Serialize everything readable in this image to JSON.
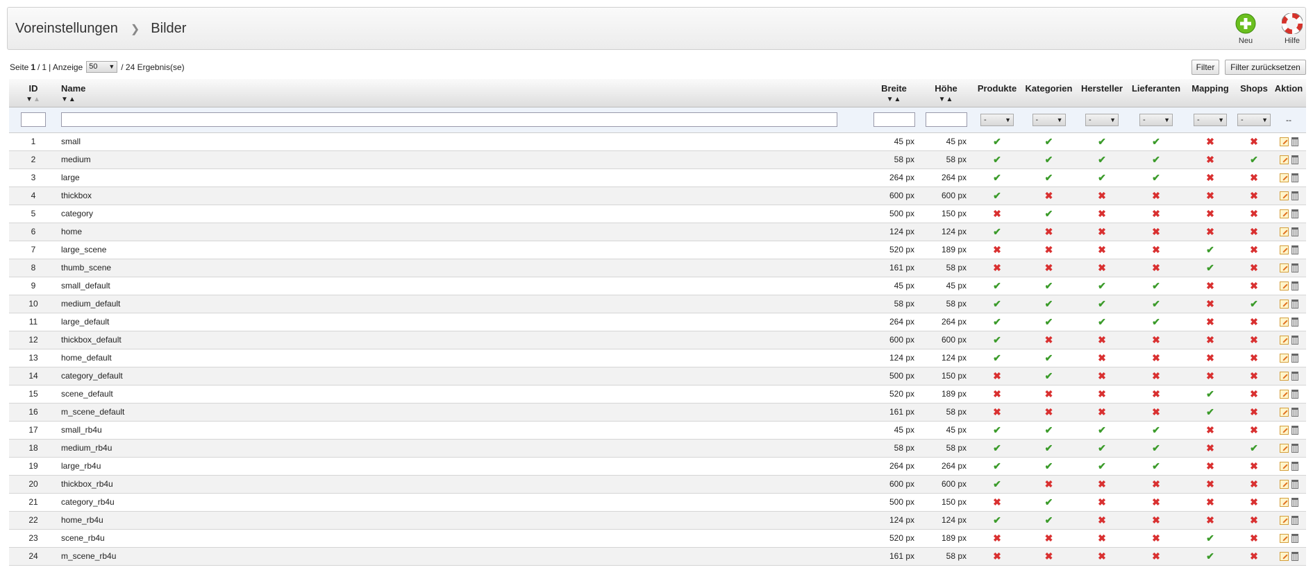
{
  "breadcrumb": {
    "parent": "Voreinstellungen",
    "current": "Bilder"
  },
  "toolbar": {
    "new_label": "Neu",
    "help_label": "Hilfe"
  },
  "pagination": {
    "page_label": "Seite",
    "page": "1",
    "sep": "/",
    "pages": "1",
    "display_label": "| Anzeige",
    "per_page": "50",
    "result_text": "/ 24 Ergebnis(se)"
  },
  "buttons": {
    "filter": "Filter",
    "reset": "Filter zurücksetzen"
  },
  "columns": {
    "id": "ID",
    "name": "Name",
    "width": "Breite",
    "height": "Höhe",
    "products": "Produkte",
    "categories": "Kategorien",
    "manufacturers": "Hersteller",
    "suppliers": "Lieferanten",
    "mapping": "Mapping",
    "shops": "Shops",
    "action": "Aktion"
  },
  "filter": {
    "select_value": "-",
    "action_placeholder": "--"
  },
  "colors": {
    "check": "#3b9b2a",
    "cross": "#d93030",
    "new_button": "#6bbf1f"
  },
  "rows": [
    {
      "id": "1",
      "name": "small",
      "w": "45 px",
      "h": "45 px",
      "f": [
        1,
        1,
        1,
        1,
        0,
        0
      ]
    },
    {
      "id": "2",
      "name": "medium",
      "w": "58 px",
      "h": "58 px",
      "f": [
        1,
        1,
        1,
        1,
        0,
        1
      ]
    },
    {
      "id": "3",
      "name": "large",
      "w": "264 px",
      "h": "264 px",
      "f": [
        1,
        1,
        1,
        1,
        0,
        0
      ]
    },
    {
      "id": "4",
      "name": "thickbox",
      "w": "600 px",
      "h": "600 px",
      "f": [
        1,
        0,
        0,
        0,
        0,
        0
      ]
    },
    {
      "id": "5",
      "name": "category",
      "w": "500 px",
      "h": "150 px",
      "f": [
        0,
        1,
        0,
        0,
        0,
        0
      ]
    },
    {
      "id": "6",
      "name": "home",
      "w": "124 px",
      "h": "124 px",
      "f": [
        1,
        0,
        0,
        0,
        0,
        0
      ]
    },
    {
      "id": "7",
      "name": "large_scene",
      "w": "520 px",
      "h": "189 px",
      "f": [
        0,
        0,
        0,
        0,
        1,
        0
      ]
    },
    {
      "id": "8",
      "name": "thumb_scene",
      "w": "161 px",
      "h": "58 px",
      "f": [
        0,
        0,
        0,
        0,
        1,
        0
      ]
    },
    {
      "id": "9",
      "name": "small_default",
      "w": "45 px",
      "h": "45 px",
      "f": [
        1,
        1,
        1,
        1,
        0,
        0
      ]
    },
    {
      "id": "10",
      "name": "medium_default",
      "w": "58 px",
      "h": "58 px",
      "f": [
        1,
        1,
        1,
        1,
        0,
        1
      ]
    },
    {
      "id": "11",
      "name": "large_default",
      "w": "264 px",
      "h": "264 px",
      "f": [
        1,
        1,
        1,
        1,
        0,
        0
      ]
    },
    {
      "id": "12",
      "name": "thickbox_default",
      "w": "600 px",
      "h": "600 px",
      "f": [
        1,
        0,
        0,
        0,
        0,
        0
      ]
    },
    {
      "id": "13",
      "name": "home_default",
      "w": "124 px",
      "h": "124 px",
      "f": [
        1,
        1,
        0,
        0,
        0,
        0
      ]
    },
    {
      "id": "14",
      "name": "category_default",
      "w": "500 px",
      "h": "150 px",
      "f": [
        0,
        1,
        0,
        0,
        0,
        0
      ]
    },
    {
      "id": "15",
      "name": "scene_default",
      "w": "520 px",
      "h": "189 px",
      "f": [
        0,
        0,
        0,
        0,
        1,
        0
      ]
    },
    {
      "id": "16",
      "name": "m_scene_default",
      "w": "161 px",
      "h": "58 px",
      "f": [
        0,
        0,
        0,
        0,
        1,
        0
      ]
    },
    {
      "id": "17",
      "name": "small_rb4u",
      "w": "45 px",
      "h": "45 px",
      "f": [
        1,
        1,
        1,
        1,
        0,
        0
      ]
    },
    {
      "id": "18",
      "name": "medium_rb4u",
      "w": "58 px",
      "h": "58 px",
      "f": [
        1,
        1,
        1,
        1,
        0,
        1
      ]
    },
    {
      "id": "19",
      "name": "large_rb4u",
      "w": "264 px",
      "h": "264 px",
      "f": [
        1,
        1,
        1,
        1,
        0,
        0
      ]
    },
    {
      "id": "20",
      "name": "thickbox_rb4u",
      "w": "600 px",
      "h": "600 px",
      "f": [
        1,
        0,
        0,
        0,
        0,
        0
      ]
    },
    {
      "id": "21",
      "name": "category_rb4u",
      "w": "500 px",
      "h": "150 px",
      "f": [
        0,
        1,
        0,
        0,
        0,
        0
      ]
    },
    {
      "id": "22",
      "name": "home_rb4u",
      "w": "124 px",
      "h": "124 px",
      "f": [
        1,
        1,
        0,
        0,
        0,
        0
      ]
    },
    {
      "id": "23",
      "name": "scene_rb4u",
      "w": "520 px",
      "h": "189 px",
      "f": [
        0,
        0,
        0,
        0,
        1,
        0
      ]
    },
    {
      "id": "24",
      "name": "m_scene_rb4u",
      "w": "161 px",
      "h": "58 px",
      "f": [
        0,
        0,
        0,
        0,
        1,
        0
      ]
    }
  ]
}
